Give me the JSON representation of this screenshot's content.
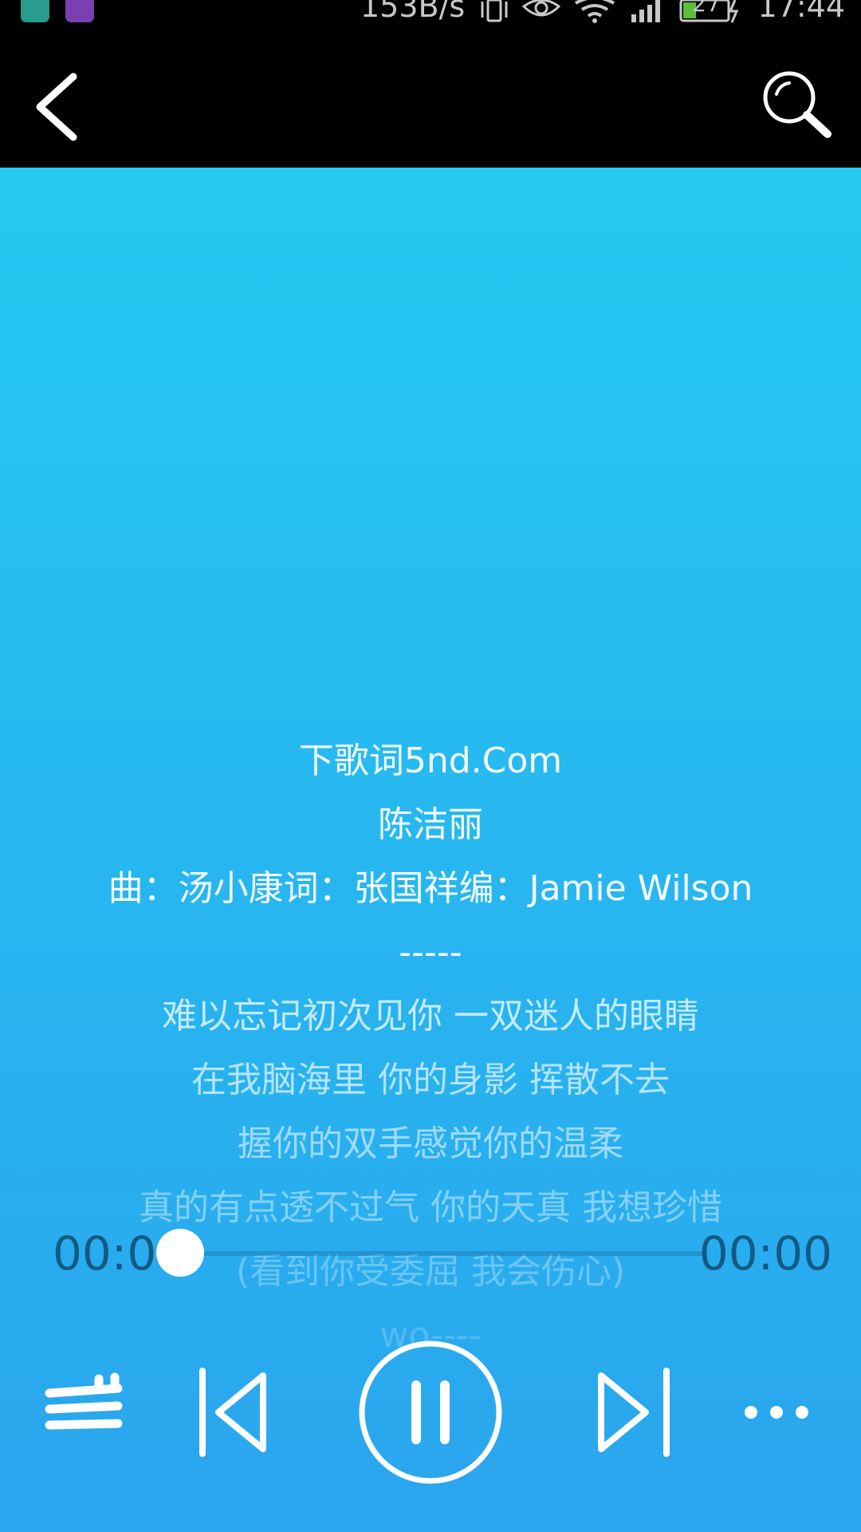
{
  "status_bar": {
    "net_speed": "153B/s",
    "battery_level": "27",
    "time": "17:44",
    "icons": [
      "android-notification-icon",
      "gallery-notification-icon",
      "vibrate-icon",
      "eye-icon",
      "wifi-icon",
      "signal-icon",
      "battery-charging-icon"
    ]
  },
  "header": {
    "back_icon": "chevron-left-icon",
    "search_icon": "search-icon"
  },
  "lyrics": {
    "lines": [
      "下歌词5nd.Com",
      "陈洁丽",
      "曲：汤小康词：张国祥编：Jamie Wilson",
      "-----",
      "难以忘记初次见你 一双迷人的眼睛",
      "在我脑海里 你的身影 挥散不去",
      "握你的双手感觉你的温柔",
      "真的有点透不过气 你的天真 我想珍惜",
      "(看到你受委屈 我会伤心)",
      "wo----"
    ]
  },
  "progress": {
    "current_time": "00:00",
    "total_time": "00:00",
    "fraction": 0
  },
  "controls": {
    "playlist_icon": "playlist-icon",
    "previous_icon": "previous-track-icon",
    "pause_icon": "pause-icon",
    "next_icon": "next-track-icon",
    "more_icon": "more-options-icon"
  },
  "colors": {
    "background_top": "#25c9f1",
    "background_bottom": "#2aa5ee",
    "time_text": "#135a82",
    "header_bg": "#000000"
  }
}
